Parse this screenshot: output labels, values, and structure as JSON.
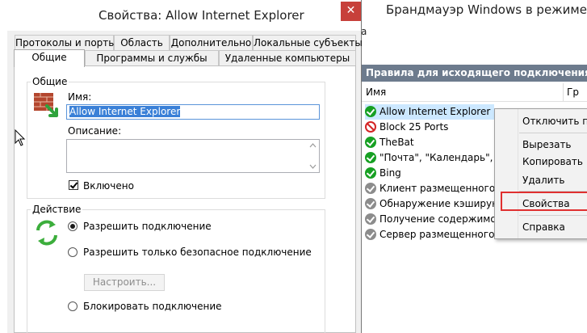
{
  "background_window": {
    "title": "Брандмауэр Windows в режиме по",
    "menu_fragment": "а",
    "panel_header": "Правила для исходящего подключения",
    "columns": [
      "Имя",
      "Гр"
    ],
    "rules": [
      {
        "name": "Allow Internet Explorer",
        "icon": "green-check-icon",
        "selected": true
      },
      {
        "name": "Block 25 Ports",
        "icon": "block-icon"
      },
      {
        "name": "TheBat",
        "icon": "green-check-icon"
      },
      {
        "name": "\"Почта\", \"Календарь\", \"Лю",
        "icon": "green-check-icon"
      },
      {
        "name": "Bing",
        "icon": "green-check-icon"
      },
      {
        "name": "Клиент размещенного кэ",
        "icon": "grey-check-icon"
      },
      {
        "name": "Обнаружение кэширующ",
        "icon": "grey-check-icon"
      },
      {
        "name": "Получение содержимого",
        "icon": "grey-check-icon"
      },
      {
        "name": "Сервер размещенного кэ",
        "icon": "grey-check-icon"
      }
    ]
  },
  "context_menu": {
    "items": [
      "Отключить п",
      "Вырезать",
      "Копировать",
      "Удалить",
      "Свойства",
      "Справка"
    ],
    "highlight_color": "#e03030"
  },
  "dialog": {
    "title": "Свойства: Allow Internet Explorer",
    "close_glyph": "✕",
    "tabs_row1": [
      "Протоколы и порты",
      "Область",
      "Дополнительно",
      "Локальные субъекты"
    ],
    "tabs_row2": [
      "Общие",
      "Программы и службы",
      "Удаленные компьютеры"
    ],
    "general": {
      "group_label": "Общие",
      "name_label": "Имя:",
      "name_value": "Allow Internet Explorer",
      "description_label": "Описание:",
      "description_value": "",
      "enabled_label": "Включено",
      "enabled": true
    },
    "action": {
      "group_label": "Действие",
      "options": [
        "Разрешить подключение",
        "Разрешить только безопасное подключение",
        "Блокировать подключение"
      ],
      "selected": 0,
      "customize_label": "Настроить..."
    }
  },
  "colors": {
    "accent": "#3a80d7",
    "panel_header": "#6d7b8d",
    "close": "#c7403a"
  }
}
